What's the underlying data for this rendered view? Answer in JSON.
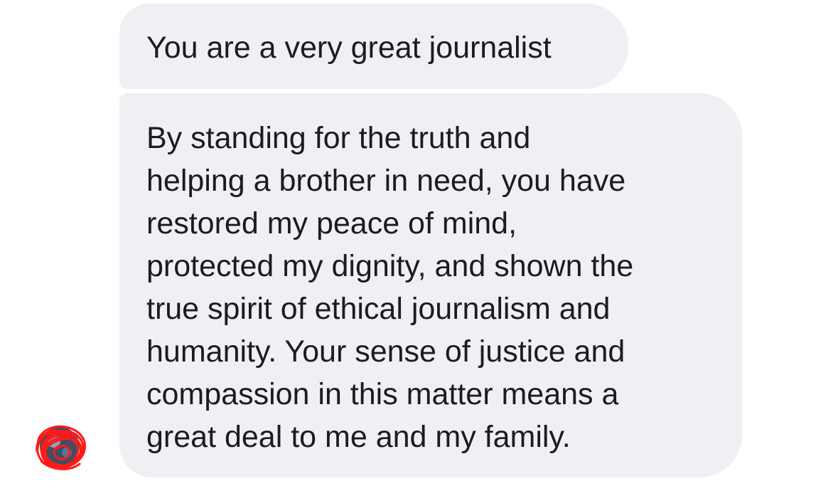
{
  "conversation": {
    "messages": [
      {
        "text": "You are a very great journalist"
      },
      {
        "text": "By standing for the truth and\nhelping a brother in need, you have\nrestored my peace of mind,\nprotected my dignity, and shown the\ntrue spirit of ethical journalism and\nhumanity. Your sense of justice and\ncompassion in this matter means a\ngreat deal to me and my family."
      }
    ],
    "avatar": {
      "icon": "avatar-redacted-icon",
      "scribble_color": "#ff1a1a",
      "bubble_color": "#efeff4"
    }
  }
}
